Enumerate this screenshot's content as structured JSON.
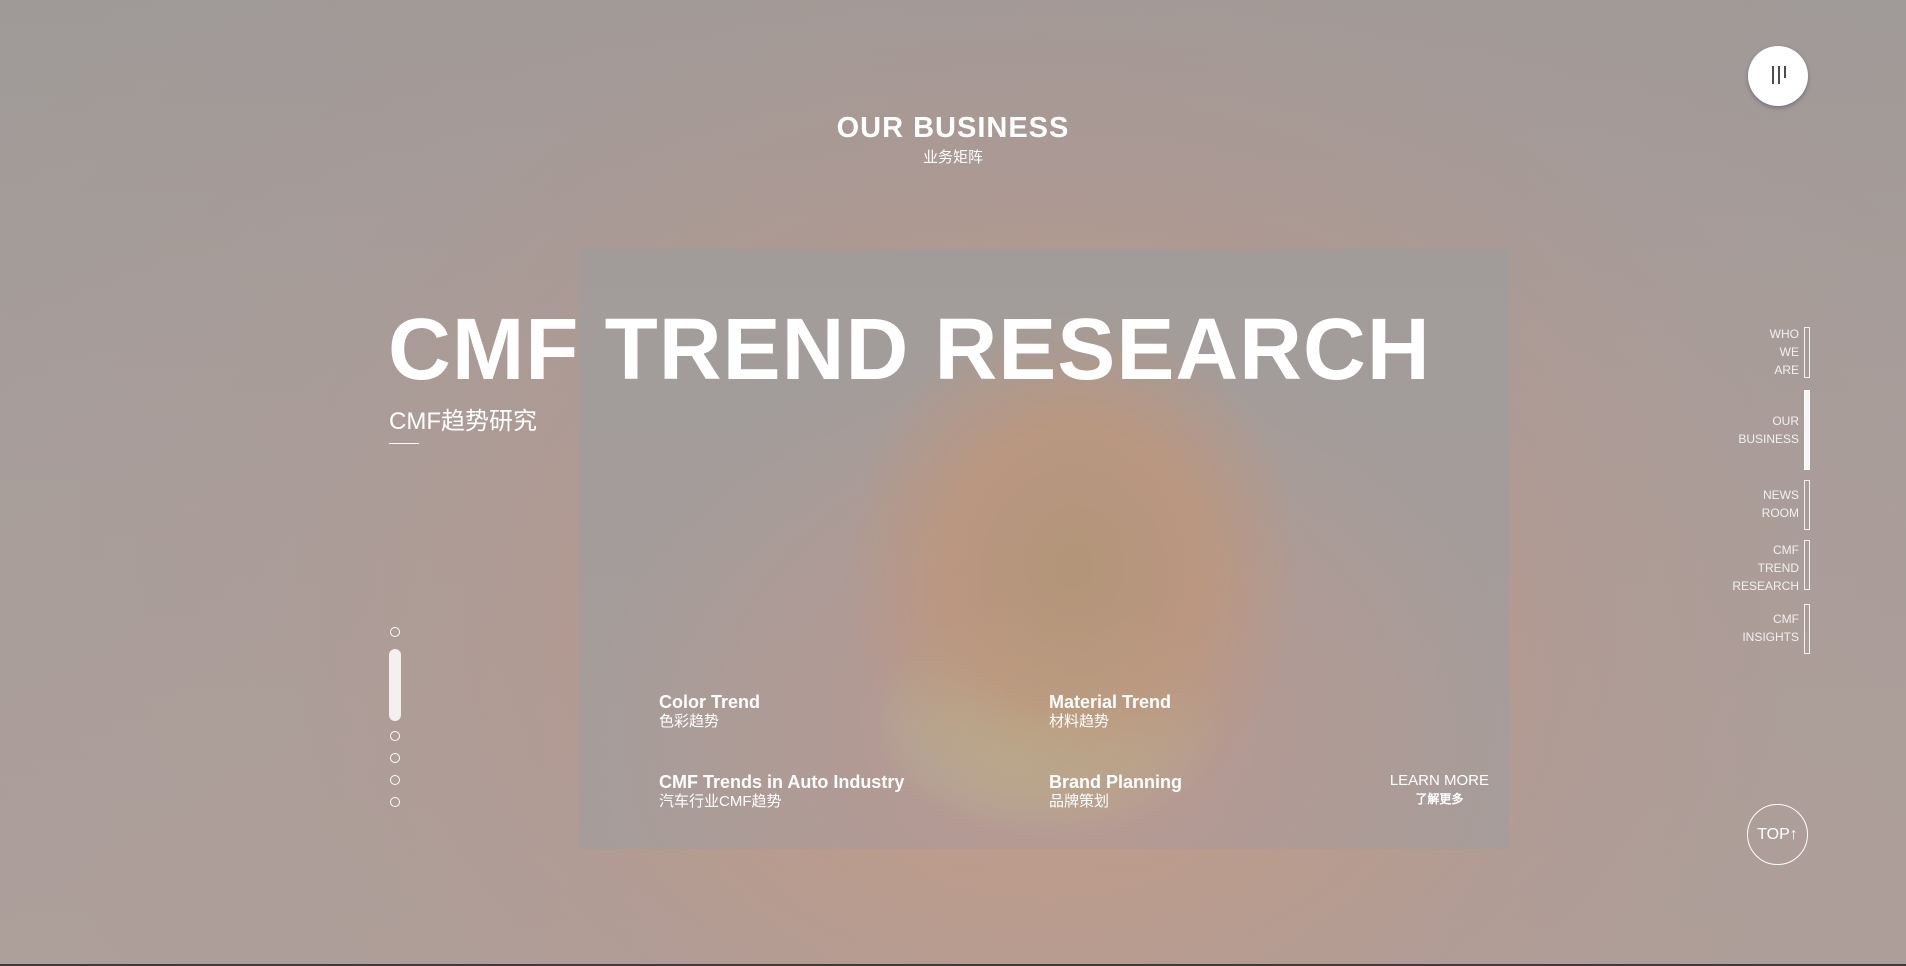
{
  "section": {
    "title": "OUR BUSINESS",
    "subtitle": "业务矩阵"
  },
  "hero": {
    "title": "CMF TREND RESEARCH",
    "subtitle": "CMF趋势研究"
  },
  "card": {
    "items": [
      {
        "en": "Color Trend",
        "zh": "色彩趋势"
      },
      {
        "en": "Material Trend",
        "zh": "材料趋势"
      },
      {
        "en": "CMF Trends in Auto Industry",
        "zh": "汽车行业CMF趋势"
      },
      {
        "en": "Brand Planning",
        "zh": "品牌策划"
      }
    ],
    "learn_more": {
      "en": "LEARN MORE",
      "zh": "了解更多"
    }
  },
  "pager": {
    "count": 6,
    "active_index": 1
  },
  "side_nav": {
    "items": [
      {
        "label_lines": [
          "WHO",
          "WE",
          "ARE"
        ],
        "active": false
      },
      {
        "label_lines": [
          "OUR",
          "BUSINESS"
        ],
        "active": true
      },
      {
        "label_lines": [
          "NEWS",
          "ROOM"
        ],
        "active": false
      },
      {
        "label_lines": [
          "CMF",
          "TREND",
          "RESEARCH"
        ],
        "active": false
      },
      {
        "label_lines": [
          "CMF",
          "INSIGHTS"
        ],
        "active": false
      }
    ]
  },
  "top_button": {
    "label": "TOP↑"
  },
  "icons": {
    "menu": "menu-bars-icon"
  }
}
